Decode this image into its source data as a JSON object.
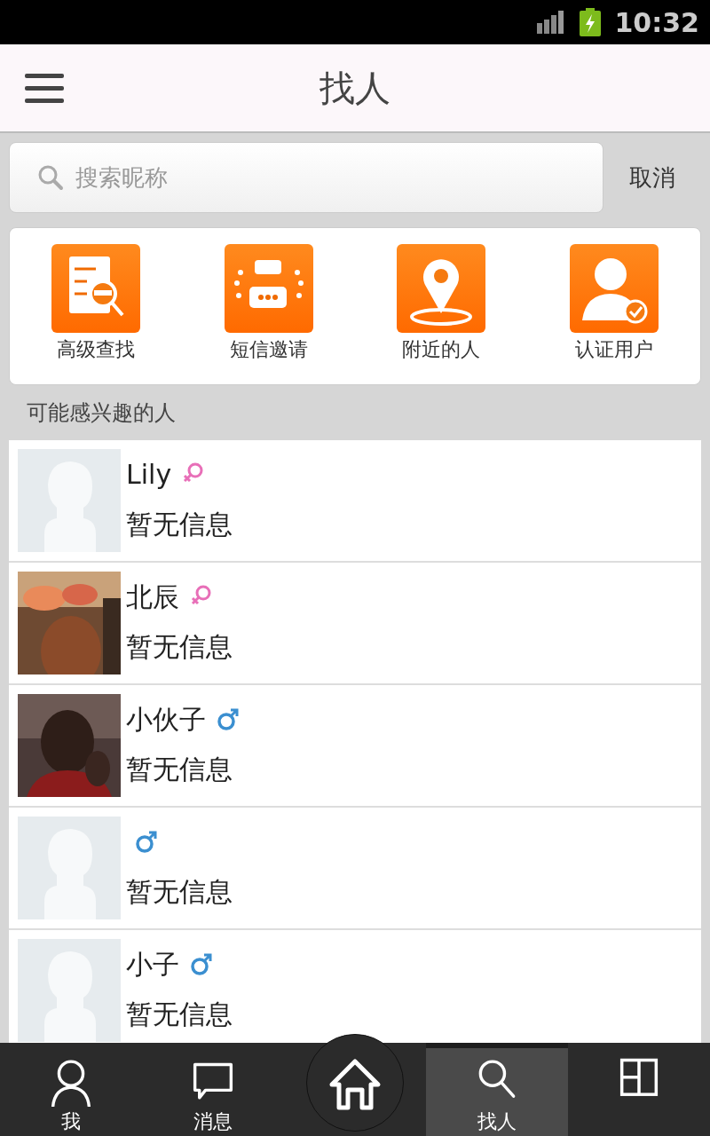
{
  "status_bar": {
    "time": "10:32"
  },
  "header": {
    "title": "找人"
  },
  "search": {
    "placeholder": "搜索昵称",
    "cancel": "取消"
  },
  "shortcuts": [
    {
      "kind": "advanced",
      "label": "高级查找"
    },
    {
      "kind": "sms",
      "label": "短信邀请"
    },
    {
      "kind": "nearby",
      "label": "附近的人"
    },
    {
      "kind": "verified",
      "label": "认证用户"
    }
  ],
  "section_title": "可能感兴趣的人",
  "people": [
    {
      "name": "Lily",
      "gender_icon": {
        "kind": "female"
      },
      "avatar": {
        "kind": "placeholder"
      },
      "info": "暂无信息"
    },
    {
      "name": "北辰",
      "gender_icon": {
        "kind": "female"
      },
      "info": "暂无信息"
    },
    {
      "name": "小伙子",
      "gender_icon": {
        "kind": "male"
      },
      "info": "暂无信息"
    },
    {
      "gender_icon": {
        "kind": "male"
      },
      "avatar": {
        "kind": "placeholder"
      },
      "info": "暂无信息"
    },
    {
      "name": "小子",
      "gender_icon": {
        "kind": "male"
      },
      "avatar": {
        "kind": "placeholder"
      },
      "info": "暂无信息"
    }
  ],
  "bottom_nav": [
    {
      "kind": "me",
      "label": "我",
      "selected": false
    },
    {
      "kind": "messages",
      "label": "消息",
      "selected": false
    },
    {
      "kind": "home",
      "selected": false
    },
    {
      "kind": "find",
      "label": "找人",
      "selected": true
    },
    {
      "kind": "grid",
      "selected": false
    }
  ]
}
